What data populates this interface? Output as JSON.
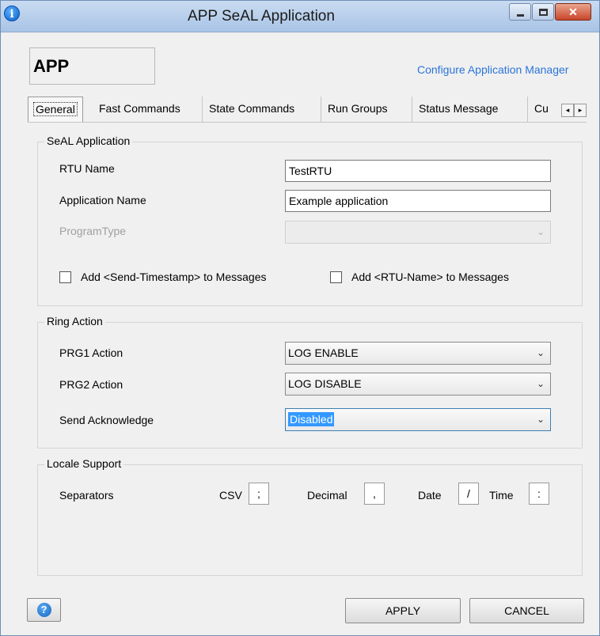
{
  "window": {
    "title": "APP SeAL Application",
    "close_glyph": "✕"
  },
  "header": {
    "app_code": "APP",
    "configure_link": "Configure Application Manager"
  },
  "tabs": [
    {
      "label": "General",
      "active": true
    },
    {
      "label": "Fast Commands"
    },
    {
      "label": "State Commands"
    },
    {
      "label": "Run Groups"
    },
    {
      "label": "Status Message"
    },
    {
      "label": "Cu"
    }
  ],
  "tab_scroll": {
    "left": "◂",
    "right": "▸"
  },
  "seal_application": {
    "title": "SeAL Application",
    "rtu_name_label": "RTU Name",
    "rtu_name_value": "TestRTU",
    "app_name_label": "Application Name",
    "app_name_value": "Example application",
    "program_type_label": "ProgramType",
    "program_type_value": "",
    "send_timestamp_label": "Add <Send-Timestamp> to Messages",
    "send_timestamp_checked": false,
    "rtu_name_msg_label": "Add <RTU-Name> to Messages",
    "rtu_name_msg_checked": false
  },
  "ring_action": {
    "title": "Ring Action",
    "prg1_label": "PRG1 Action",
    "prg1_value": "LOG ENABLE",
    "prg2_label": "PRG2  Action",
    "prg2_value": "LOG DISABLE",
    "ack_label": "Send Acknowledge",
    "ack_value": "Disabled"
  },
  "locale_support": {
    "title": "Locale Support",
    "separators_label": "Separators",
    "csv_label": "CSV",
    "csv_value": ";",
    "decimal_label": "Decimal",
    "decimal_value": ",",
    "date_label": "Date",
    "date_value": "/",
    "time_label": "Time",
    "time_value": ":"
  },
  "footer": {
    "help_glyph": "?",
    "apply_label": "APPLY",
    "cancel_label": "CANCEL"
  },
  "chevron_glyph": "⌄",
  "colors": {
    "link": "#2a74d9",
    "selection": "#3399ff",
    "titlebar": "#a9c4e6"
  }
}
